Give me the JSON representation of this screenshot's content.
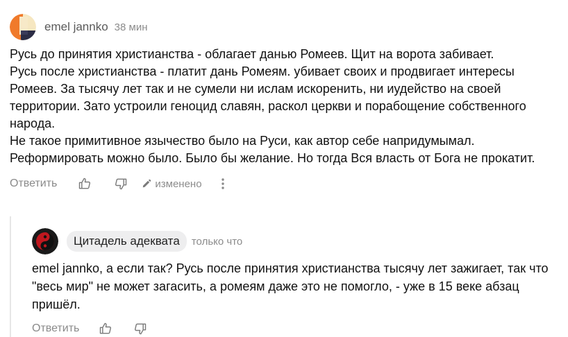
{
  "comment": {
    "author": "emel jannko",
    "time": "38 мин",
    "text_lines": [
      "Русь до принятия христианства - облагает данью Ромеев. Щит на ворота забивает.",
      "Русь после христианства - платит дань Ромеям. убивает своих и продвигает интересы Ромеев. За тысячу лет так и не сумели ни ислам искоренить, ни иудейство на своей территории. Зато устроили геноцид славян, раскол церкви и порабощение собственного народа.",
      "Не такое примитивное язычество было на Руси, как автор себе напридумымал. Реформировать можно было. Было бы желание. Но тогда Вся власть от Бога не прокатит."
    ],
    "actions": {
      "reply_label": "Ответить",
      "like_icon": "thumbs-up-icon",
      "dislike_icon": "thumbs-down-icon",
      "edited_label": "изменено",
      "more_icon": "more-vertical-icon"
    }
  },
  "reply": {
    "author": "Цитадель адекватa",
    "time": "только что",
    "text": "emel jannko, а если так? Русь после принятия христианства тысячу лет зажигает, так что \"весь мир\" не может загасить, а ромеям даже это не помогло, - уже в 15 веке абзац пришёл.",
    "actions": {
      "reply_label": "Ответить",
      "like_icon": "thumbs-up-icon",
      "dislike_icon": "thumbs-down-icon"
    }
  },
  "colors": {
    "text": "#111111",
    "muted": "#8c8c8c",
    "author_chip_bg": "#eeeeef",
    "thread_line": "#e6e6e6"
  }
}
